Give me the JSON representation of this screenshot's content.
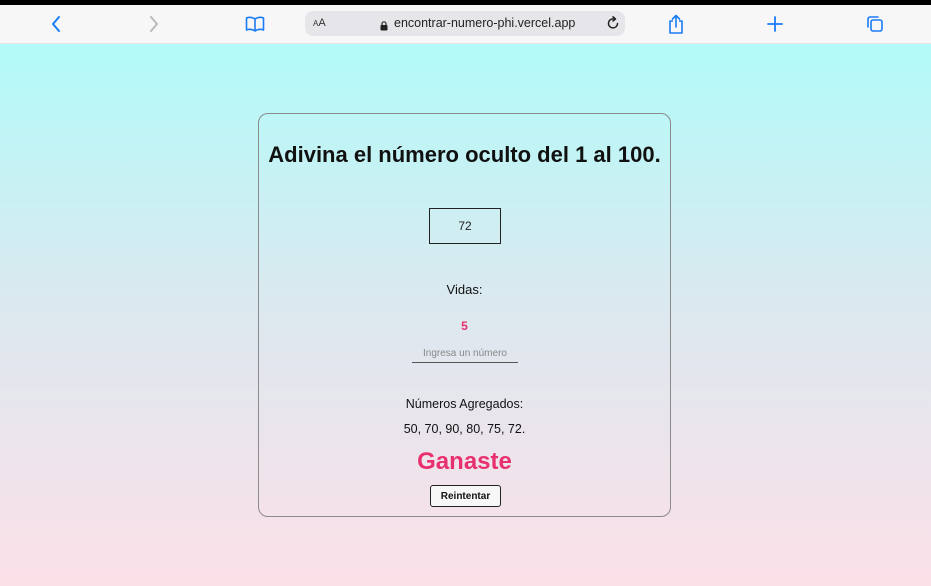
{
  "browser": {
    "url": "encontrar-numero-phi.vercel.app",
    "aa_small": "A",
    "aa_large": "A",
    "accent_color": "#1a7cf5"
  },
  "game": {
    "title": "Adivina el número oculto del 1 al 100.",
    "current_guess": "72",
    "lives_label": "Vidas:",
    "lives_value": "5",
    "input_placeholder": "Ingresa un número",
    "added_label": "Números Agregados:",
    "added_values": "50, 70, 90, 80, 75, 72.",
    "result": "Ganaste",
    "retry_label": "Reintentar",
    "highlight_color": "#e8306f"
  }
}
